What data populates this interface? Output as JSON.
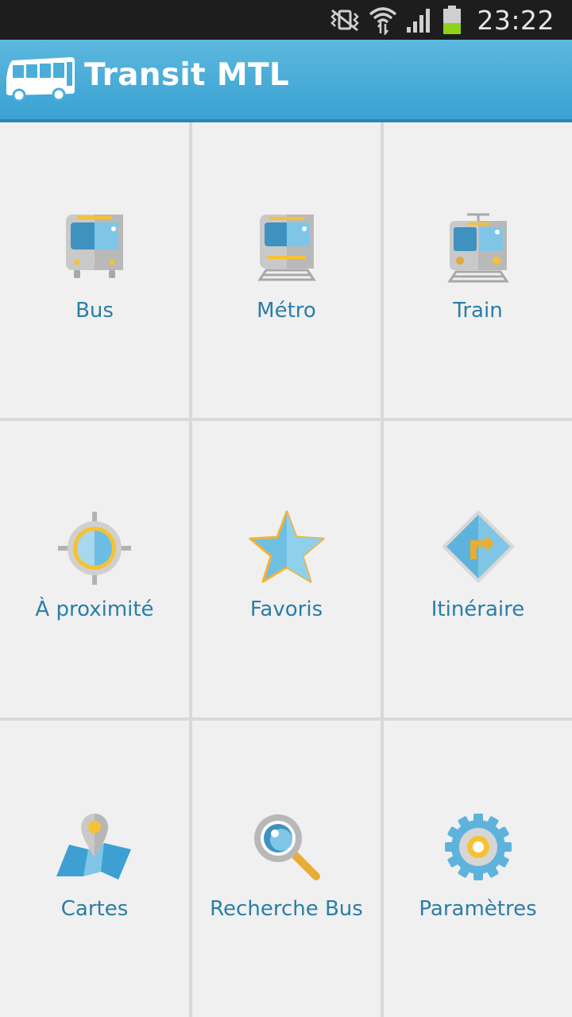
{
  "status_bar": {
    "time": "23:22",
    "icons": [
      "vibrate-icon",
      "wifi-icon",
      "signal-icon",
      "battery-icon"
    ]
  },
  "app_bar": {
    "title": "Transit MTL",
    "logo": "bus-logo-icon"
  },
  "tiles": [
    {
      "label": "Bus",
      "icon": "bus-icon"
    },
    {
      "label": "Métro",
      "icon": "metro-icon"
    },
    {
      "label": "Train",
      "icon": "train-icon"
    },
    {
      "label": "À proximité",
      "icon": "crosshair-icon"
    },
    {
      "label": "Favoris",
      "icon": "star-icon"
    },
    {
      "label": "Itinéraire",
      "icon": "route-sign-icon"
    },
    {
      "label": "Cartes",
      "icon": "map-pin-icon"
    },
    {
      "label": "Recherche Bus",
      "icon": "magnifier-icon"
    },
    {
      "label": "Paramètres",
      "icon": "gear-icon"
    }
  ],
  "colors": {
    "accent": "#3aa2d2",
    "label_text": "#2a7ea8",
    "icon_blue": "#5bb6e0",
    "icon_yellow": "#f6c233",
    "status_bar": "#1d1d1d"
  }
}
